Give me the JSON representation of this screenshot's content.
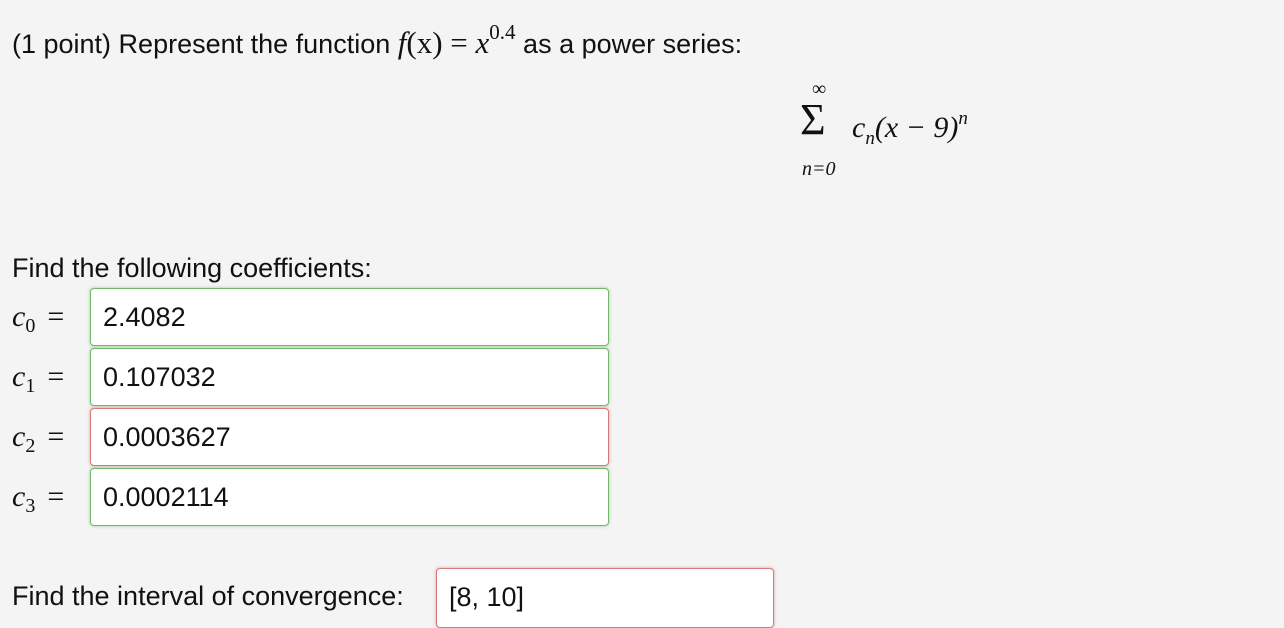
{
  "problem": {
    "prefix": "(1 point) Represent the function",
    "function_lhs": "f",
    "function_arg": "(x)",
    "equals": "=",
    "base": "x",
    "exponent": "0.4",
    "suffix": "as a power series:"
  },
  "series": {
    "upper": "∞",
    "sigma": "Σ",
    "lower": "n=0",
    "coef": "c",
    "coef_sub": "n",
    "body": "(x − 9)",
    "power": "n"
  },
  "coefficients_heading": "Find the following coefficients:",
  "coefficients": [
    {
      "letter": "c",
      "index": "0",
      "equals": "=",
      "value": "2.4082",
      "status": "correct"
    },
    {
      "letter": "c",
      "index": "1",
      "equals": "=",
      "value": "0.107032",
      "status": "correct"
    },
    {
      "letter": "c",
      "index": "2",
      "equals": "=",
      "value": "0.0003627",
      "status": "incorrect"
    },
    {
      "letter": "c",
      "index": "3",
      "equals": "=",
      "value": "0.0002114",
      "status": "correct"
    }
  ],
  "interval": {
    "label": "Find the interval of convergence:",
    "value": "[8, 10]",
    "status": "incorrect"
  },
  "colors": {
    "background": "#f4f4f4",
    "correct_border": "#74b86c",
    "incorrect_border": "#d47a7a"
  }
}
